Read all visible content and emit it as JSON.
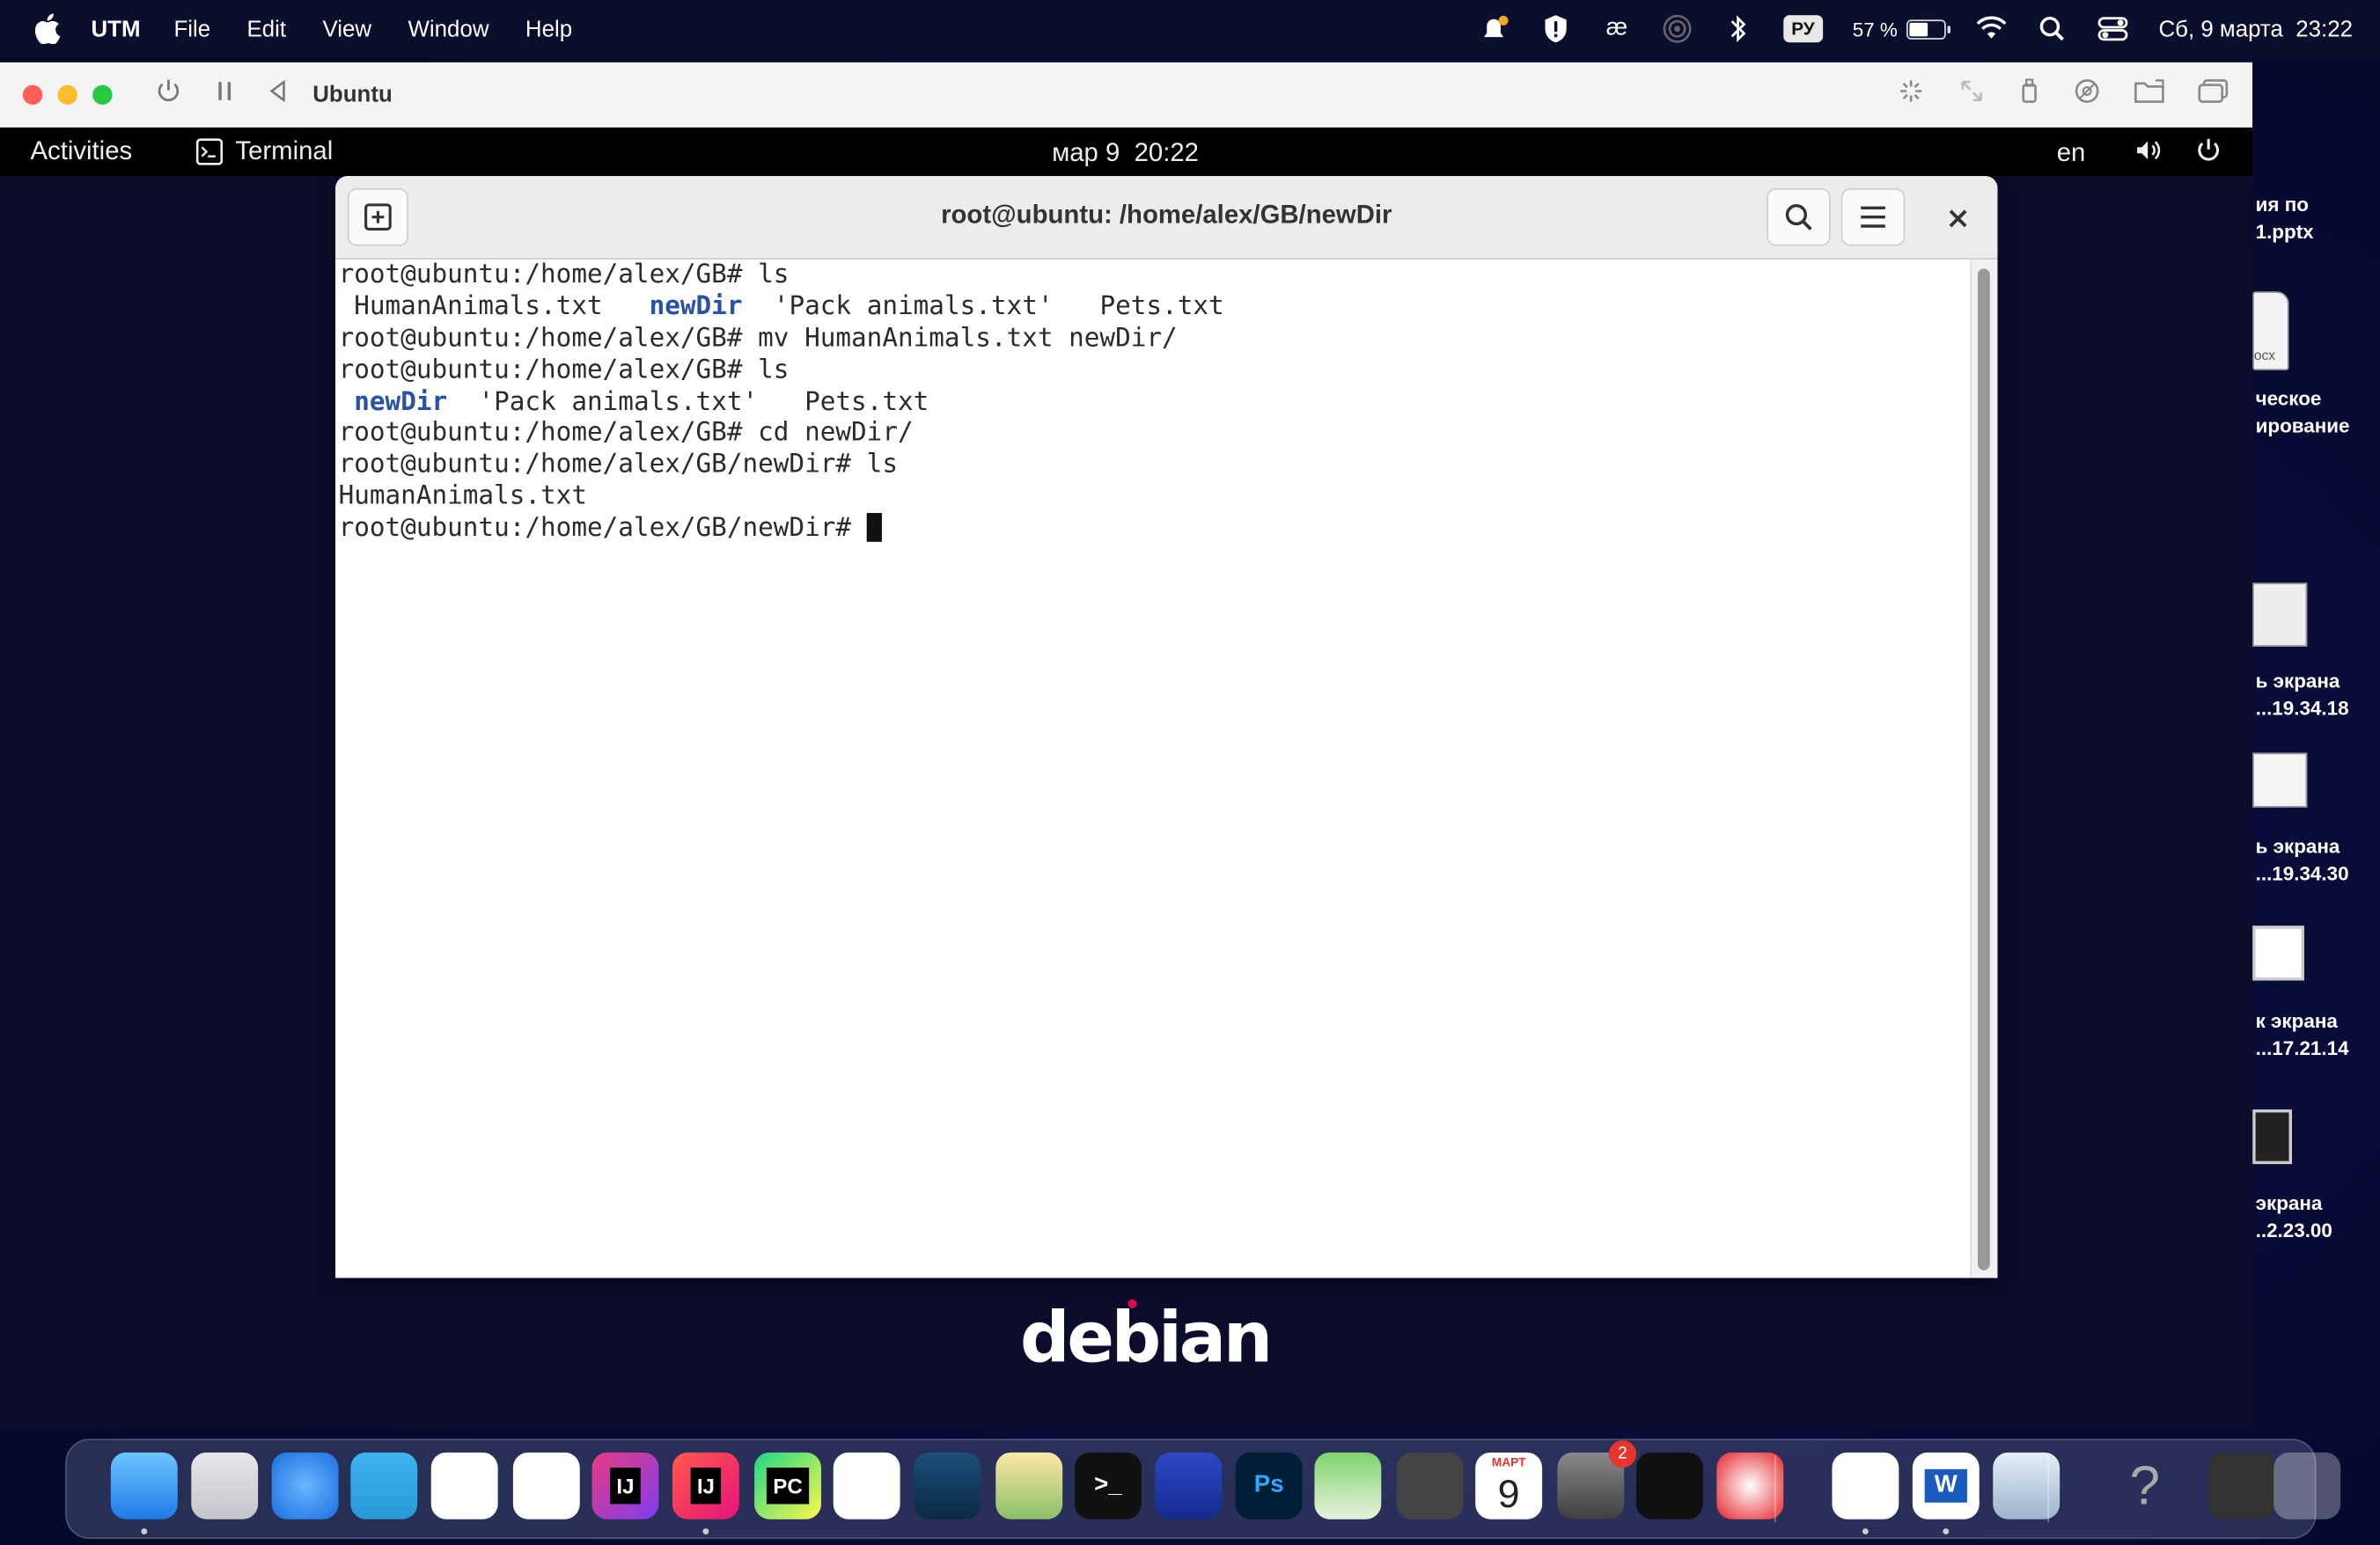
{
  "mac_menubar": {
    "app_name": "UTM",
    "menus": [
      "File",
      "Edit",
      "View",
      "Window",
      "Help"
    ],
    "input_lang": "РУ",
    "battery": "57 %",
    "battery_level": 0.57,
    "datetime": "Сб, 9 марта  23:22"
  },
  "utm": {
    "title": "Ubuntu"
  },
  "gnome": {
    "activities": "Activities",
    "app": "Terminal",
    "clock": "мар 9  20:22",
    "keyboard": "en"
  },
  "terminal": {
    "title": "root@ubuntu: /home/alex/GB/newDir",
    "lines": [
      {
        "type": "cmd",
        "text": "root@ubuntu:/home/alex/GB# ls"
      },
      {
        "type": "ls",
        "parts": [
          " HumanAnimals.txt   ",
          "newDir",
          "  'Pack animals.txt'   Pets.txt"
        ]
      },
      {
        "type": "cmd",
        "text": "root@ubuntu:/home/alex/GB# mv HumanAnimals.txt newDir/"
      },
      {
        "type": "cmd",
        "text": "root@ubuntu:/home/alex/GB# ls"
      },
      {
        "type": "ls",
        "parts": [
          " ",
          "newDir",
          "  'Pack animals.txt'   Pets.txt"
        ]
      },
      {
        "type": "cmd",
        "text": "root@ubuntu:/home/alex/GB# cd newDir/"
      },
      {
        "type": "cmd",
        "text": "root@ubuntu:/home/alex/GB/newDir# ls"
      },
      {
        "type": "out",
        "text": "HumanAnimals.txt"
      },
      {
        "type": "prompt",
        "text": "root@ubuntu:/home/alex/GB/newDir# "
      }
    ]
  },
  "desktop": {
    "items": [
      {
        "label1": "ия по",
        "label2": "1.pptx"
      },
      {
        "label1": "ческое",
        "label2": "ирование"
      },
      {
        "label1": "ь экрана",
        "label2": "...19.34.18"
      },
      {
        "label1": "ь экрана",
        "label2": "...19.34.30"
      },
      {
        "label1": "к экрана",
        "label2": "...17.21.14"
      },
      {
        "label1": "экрана",
        "label2": "..2.23.00"
      }
    ],
    "doc_badge": "ocx"
  },
  "background_text": "debian",
  "dock": {
    "badge_settings": "2",
    "calendar_month": "МАРТ",
    "calendar_day": "9",
    "apps": [
      {
        "name": "Finder",
        "label": ""
      },
      {
        "name": "Launchpad",
        "label": ""
      },
      {
        "name": "Safari",
        "label": ""
      },
      {
        "name": "Telegram",
        "label": ""
      },
      {
        "name": "VS Code",
        "label": ""
      },
      {
        "name": "Chrome",
        "label": ""
      },
      {
        "name": "IntelliJ IDEA CE",
        "label": "IJ"
      },
      {
        "name": "IntelliJ IDEA",
        "label": "IJ"
      },
      {
        "name": "PyCharm",
        "label": "PC"
      },
      {
        "name": "Docker",
        "label": ""
      },
      {
        "name": "MySQL Workbench",
        "label": ""
      },
      {
        "name": "Grapher",
        "label": ""
      },
      {
        "name": "Terminal",
        "label": ">_"
      },
      {
        "name": "UTM",
        "label": ""
      },
      {
        "name": "Photoshop",
        "label": "Ps"
      },
      {
        "name": "Maps",
        "label": ""
      },
      {
        "name": "Calculator",
        "label": ""
      },
      {
        "name": "Calendar",
        "label": ""
      },
      {
        "name": "System Settings",
        "label": ""
      },
      {
        "name": "Quick Look",
        "label": ""
      },
      {
        "name": "Opera",
        "label": ""
      },
      {
        "name": "PowerPoint",
        "label": ""
      },
      {
        "name": "Word",
        "label": "W"
      },
      {
        "name": "Preview",
        "label": ""
      },
      {
        "name": "Help",
        "label": "?"
      },
      {
        "name": "Recent window",
        "label": ""
      },
      {
        "name": "Trash",
        "label": ""
      }
    ]
  },
  "colors": {
    "dir_blue": "#2852a4",
    "mac_red": "#fe5f57",
    "mac_yellow": "#febc2e",
    "mac_green": "#28c840"
  }
}
